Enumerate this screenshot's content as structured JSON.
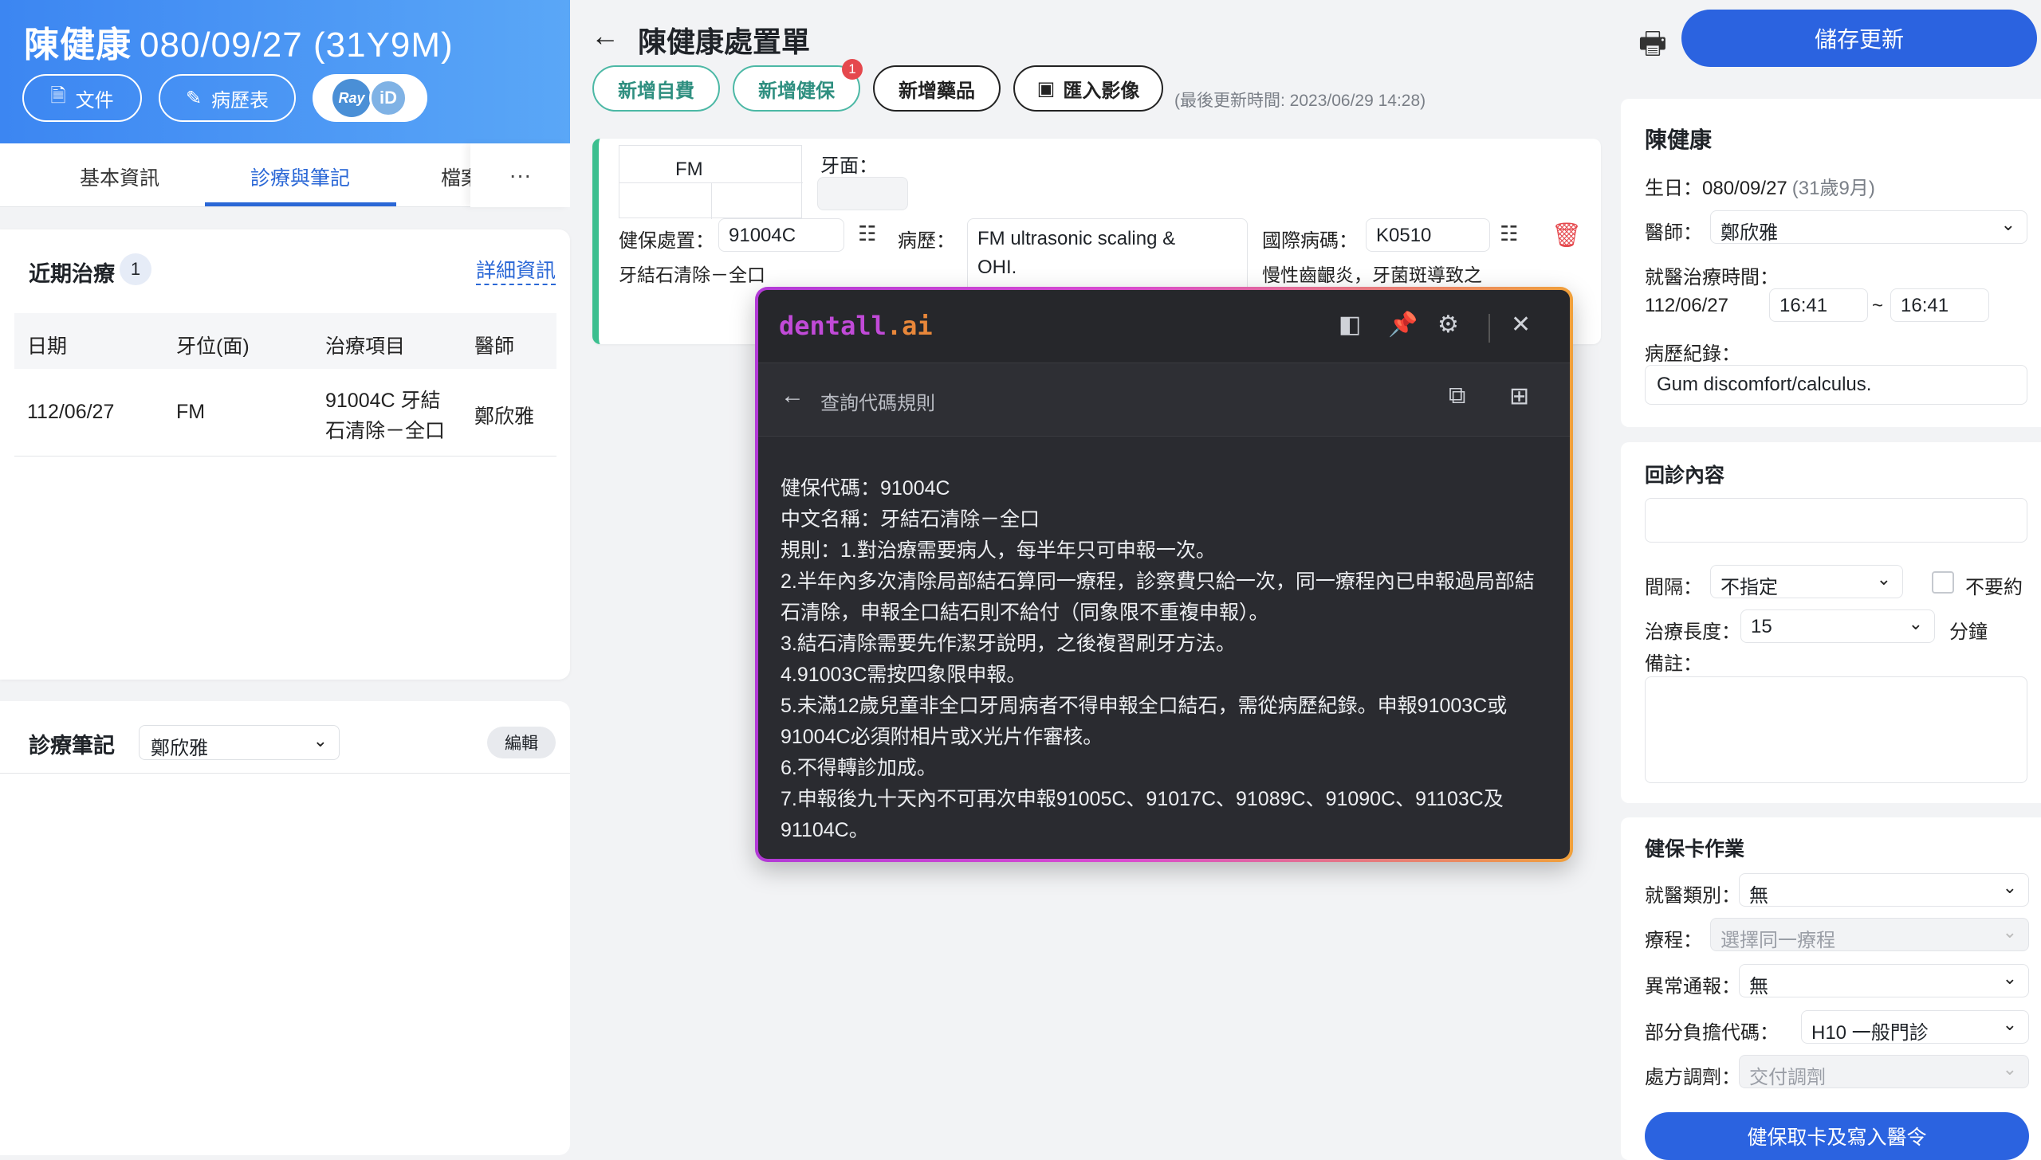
{
  "patient": {
    "name": "陳健康",
    "birth_age": "080/09/27 (31Y9M)"
  },
  "left_header": {
    "doc_button": "文件",
    "chart_button": "病歷表",
    "rayid_ray": "Ray",
    "rayid_id": "iD"
  },
  "left_tabs": {
    "basic": "基本資訊",
    "diag": "診療與筆記",
    "file": "檔案",
    "more": "···"
  },
  "recent": {
    "title": "近期治療",
    "count": "1",
    "detail_link": "詳細資訊",
    "columns": [
      "日期",
      "牙位(面)",
      "治療項目",
      "醫師"
    ],
    "rows": [
      {
        "date": "112/06/27",
        "tooth": "FM",
        "item_line1": "91004C 牙結",
        "item_line2": "石清除－全口",
        "doctor": "鄭欣雅"
      }
    ]
  },
  "notes": {
    "title": "診療筆記",
    "doctor": "鄭欣雅",
    "edit": "編輯"
  },
  "form": {
    "title": "陳健康處置單",
    "buttons": {
      "self_pay": "新增自費",
      "nhi": "新增健保",
      "nhi_badge": "1",
      "drug": "新增藥品",
      "import_image": "匯入影像"
    },
    "last_updated": "(最後更新時間: 2023/06/29 14:28)",
    "procedure": {
      "tooth": "FM",
      "surface_label": "牙面：",
      "nhi_label": "健保處置：",
      "nhi_code": "91004C",
      "nhi_name": "牙結石清除－全口",
      "history_label": "病歷：",
      "history_line1": "FM ultrasonic scaling &",
      "history_line2": "OHI.",
      "icd_label": "國際病碼：",
      "icd_code": "K0510",
      "icd_name": "慢性齒齦炎，牙菌斑導致之"
    }
  },
  "popup": {
    "brand_a": "dentall",
    "brand_b": ".ai",
    "sub_title": "查詢代碼規則",
    "lines": [
      "健保代碼：91004C",
      "中文名稱：牙結石清除－全口",
      "規則：1.對治療需要病人，每半年只可申報一次。",
      "2.半年內多次清除局部結石算同一療程，診察費只給一次，同一療程內已申報過局部結石清除，申報全口結石則不給付（同象限不重複申報）。",
      "3.結石清除需要先作潔牙說明，之後複習刷牙方法。",
      "4.91003C需按四象限申報。",
      "5.未滿12歲兒童非全口牙周病者不得申報全口結石，需從病歷紀錄。申報91003C或91004C必須附相片或X光片作審核。",
      "6.不得轉診加成。",
      "7.申報後九十天內不可再次申報91005C、91017C、91089C、91090C、91103C及91104C。"
    ]
  },
  "right": {
    "save": "儲存更新",
    "name": "陳健康",
    "birth_label": "生日：",
    "birth": "080/09/27",
    "age": "(31歲9月)",
    "doctor_label": "醫師：",
    "doctor": "鄭欣雅",
    "time_label": "就醫治療時間：",
    "date": "112/06/27",
    "start": "16:41",
    "tilde": "~",
    "end": "16:41",
    "record_label": "病歷紀錄：",
    "record": "Gum discomfort/calculus.",
    "revisit_title": "回診內容",
    "interval_label": "間隔：",
    "interval": "不指定",
    "no_appt": "不要約",
    "length_label": "治療長度：",
    "length": "15",
    "minutes": "分鐘",
    "remark_label": "備註：",
    "card_title": "健保卡作業",
    "visit_type_label": "就醫類別：",
    "visit_type": "無",
    "course_label": "療程：",
    "course": "選擇同一療程",
    "abnormal_label": "異常通報：",
    "abnormal": "無",
    "copay_label": "部分負擔代碼：",
    "copay": "H10 一般門診",
    "dispense_label": "處方調劑：",
    "dispense": "交付調劑",
    "write_btn": "健保取卡及寫入醫令"
  },
  "colors": {
    "primary": "#2b63e0",
    "header_gradient_start": "#3c86f2",
    "teal": "#4cb8a5",
    "danger": "#e5484d",
    "popup_bg": "#2a2b30"
  }
}
